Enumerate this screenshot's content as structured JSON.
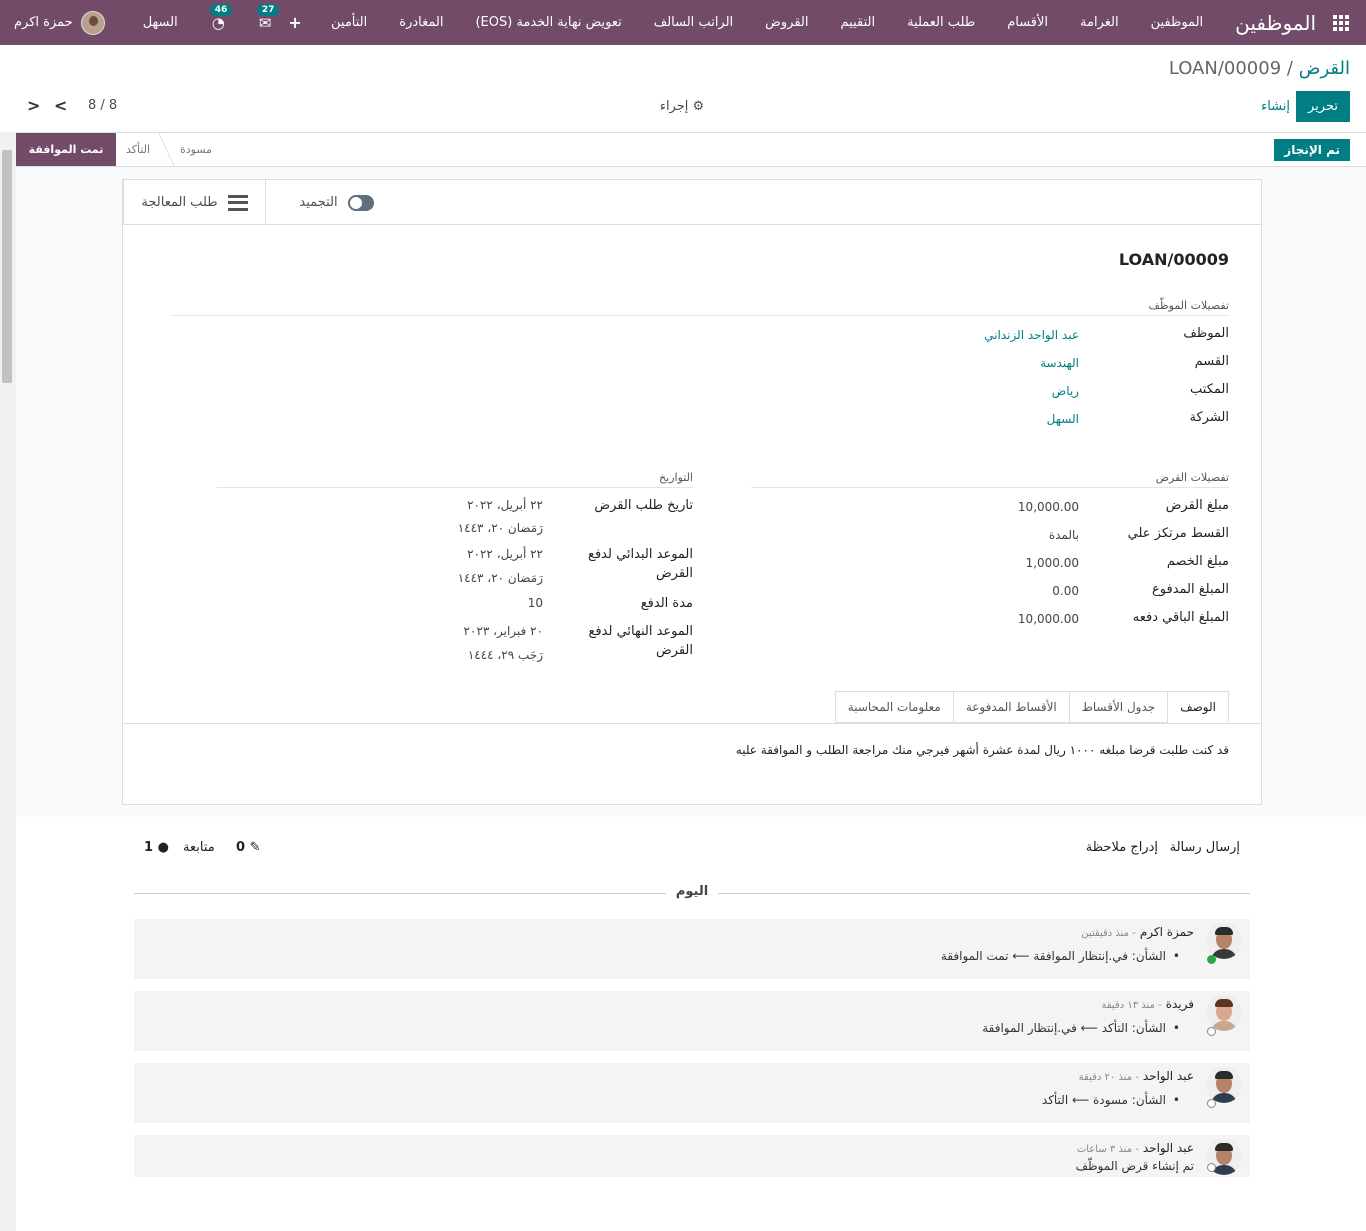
{
  "navbar": {
    "app_name": "الموظفين",
    "menu": [
      "الموظفين",
      "الغرامة",
      "الأقسام",
      "طلب العملية",
      "التقييم",
      "القروض",
      "الراتب السالف",
      "تعويض نهاية الخدمة (EOS)",
      "المغادرة",
      "التأمين"
    ],
    "plus": "+",
    "user_name": "حمزة اكرم",
    "company": "السهل",
    "messages_badge": "27",
    "activity_badge": "46"
  },
  "control": {
    "breadcrumb_parent": "القرض",
    "breadcrumb_sep": "/",
    "breadcrumb_current": "LOAN/00009",
    "edit": "تحرير",
    "create": "إنشاء",
    "action": "⚙ إجراء",
    "pager": "8 / 8"
  },
  "status": {
    "done_button": "تم الإنجاز",
    "stages": [
      "مسودة",
      "التأكد",
      "تمت الموافقة"
    ]
  },
  "smart": {
    "freeze": "التجميد",
    "processing": "طلب المعالجة"
  },
  "record": {
    "title": "LOAN/00009",
    "employee_section": "تفصيلات الموظّف",
    "employee_fields": [
      {
        "label": "الموظف",
        "value": "عبد الواحد الزنداني"
      },
      {
        "label": "القسم",
        "value": "الهندسة"
      },
      {
        "label": "المكتب",
        "value": "رياض"
      },
      {
        "label": "الشركة",
        "value": "السهل"
      }
    ],
    "loan_section": "تفصيلات القرض",
    "loan_fields": [
      {
        "label": "مبلغ القرض",
        "value": "10,000.00"
      },
      {
        "label": "القسط مرتكز علي",
        "value": "بالمدة"
      },
      {
        "label": "مبلغ الخصم",
        "value": "1,000.00"
      },
      {
        "label": "المبلغ المدفوع",
        "value": "0.00"
      },
      {
        "label": "المبلغ الباقي دفعه",
        "value": "10,000.00"
      }
    ],
    "dates_section": "التواريخ",
    "dates": {
      "request_label": "تاريخ طلب القرض",
      "request_value": [
        "٢٢ أبريل، ٢٠٢٢",
        "رَمَضان ٢٠، ١٤٤٣"
      ],
      "start_label": [
        "الموعد البدائي لدفع",
        "القرض"
      ],
      "start_value": [
        "٢٢ أبريل، ٢٠٢٢",
        "رَمَضان ٢٠، ١٤٤٣"
      ],
      "period_label": "مدة الدفع",
      "period_value": "10",
      "end_label": [
        "الموعد النهائي لدفع",
        "القرض"
      ],
      "end_value": [
        "٢٠ فبراير، ٢٠٢٣",
        "رَجَب ٢٩، ١٤٤٤"
      ]
    },
    "tabs": [
      "الوصف",
      "جدول الأقساط",
      "الأقساط المدفوعة",
      "معلومات المحاسبة"
    ],
    "description": "قد كنت طلبت قرضا مبلغه ١٠٠٠ ريال لمدة عشرة أشهر فيرجي منك مراجعة الطلب و الموافقة عليه"
  },
  "chatter": {
    "send_message": "إرسال رسالة",
    "log_note": "إدراج ملاحظة",
    "attachments": "0",
    "follow": "متابعة",
    "followers": "1",
    "today": "اليوم",
    "messages": [
      {
        "author": "حمزة اكرم",
        "ago": "- منذ دقيقتين",
        "body": "الشأن: في.إنتظار الموافقة ⟵ تمت الموافقة"
      },
      {
        "author": "فريدة",
        "ago": "- منذ ١٣ دقيقة",
        "body": "الشأن: التأكد ⟵ في.إنتظار الموافقة"
      },
      {
        "author": "عبد الواحد",
        "ago": "- منذ ٢٠ دقيقة",
        "body": "الشأن: مسودة ⟵ التأكد"
      },
      {
        "author": "عبد الواحد",
        "ago": "- منذ ٣ ساعات",
        "body": "تم إنشاء قرض الموظّف"
      }
    ]
  }
}
